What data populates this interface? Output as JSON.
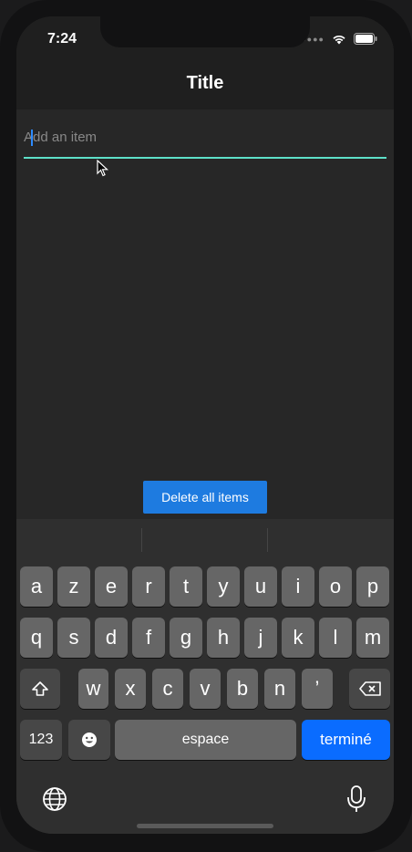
{
  "status_bar": {
    "time": "7:24"
  },
  "app_bar": {
    "title": "Title"
  },
  "input": {
    "value": "",
    "placeholder": "Add an item"
  },
  "actions": {
    "delete_all": "Delete all items"
  },
  "keyboard": {
    "row1": [
      "a",
      "z",
      "e",
      "r",
      "t",
      "y",
      "u",
      "i",
      "o",
      "p"
    ],
    "row2": [
      "q",
      "s",
      "d",
      "f",
      "g",
      "h",
      "j",
      "k",
      "l",
      "m"
    ],
    "row3": [
      "w",
      "x",
      "c",
      "v",
      "b",
      "n",
      "’"
    ],
    "numbers_key": "123",
    "space_key": "espace",
    "done_key": "terminé"
  },
  "colors": {
    "accent": "#5de0c8",
    "button": "#1e7be0",
    "done": "#0a6cff"
  }
}
